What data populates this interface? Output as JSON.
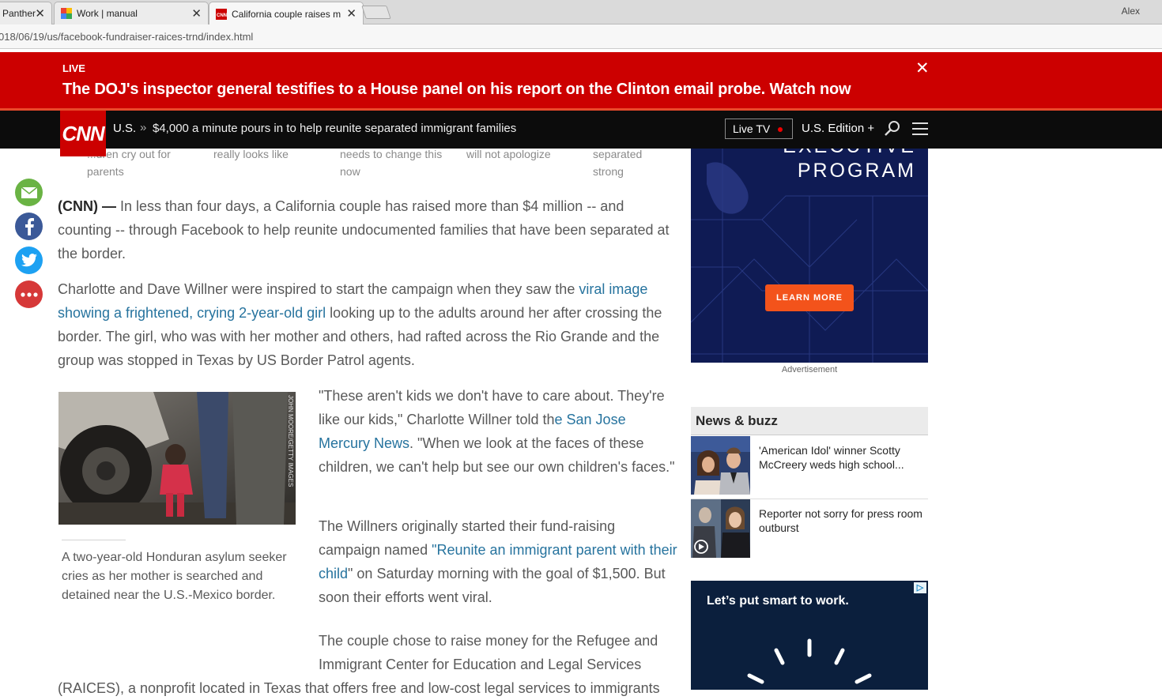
{
  "browser": {
    "tabs": [
      {
        "title": "Panther",
        "close": "✕"
      },
      {
        "title": "Work | manual",
        "close": "✕"
      },
      {
        "title": "California couple raises m",
        "close": "✕"
      }
    ],
    "user": "Alex",
    "url": "018/06/19/us/facebook-fundraiser-raices-trnd/index.html"
  },
  "live_banner": {
    "label": "LIVE",
    "message": "The DOJ's inspector general testifies to a House panel on his report on the Clinton email probe. Watch now",
    "close": "✕"
  },
  "nav": {
    "logo": "CNN",
    "section": "U.S.",
    "chevron": "»",
    "headline": "$4,000 a minute pours in to help reunite separated immigrant families",
    "live_tv": "Live TV",
    "edition": "U.S. Edition +"
  },
  "related": [
    {
      "line1": "...dren cry out for",
      "line2": "parents"
    },
    {
      "line1": "really looks like",
      "line2": ""
    },
    {
      "line1": "needs to change this",
      "line2": "now"
    },
    {
      "line1": "will not apologize",
      "line2": ""
    },
    {
      "line1": "separated",
      "line2": "strong"
    }
  ],
  "article": {
    "p1_lead": "(CNN) —",
    "p1_text": " In less than four days, a California couple has raised more than $4 million -- and counting -- through Facebook to help reunite undocumented families that have been separated at the border.",
    "p2_a": "Charlotte and Dave Willner were inspired to start the campaign when they saw the ",
    "p2_link": "viral image showing a frightened, crying 2-year-old girl",
    "p2_b": " looking up to the adults around her after crossing the border. The girl, who was with her mother and others, had rafted across the Rio Grande and the group was stopped in Texas by US Border Patrol agents.",
    "p3_a": "\"These aren't kids we don't have to care about. They're like our kids,\" Charlotte Willner told th",
    "p3_link": "e San Jose Mercury News",
    "p3_b": ". \"When we look at the faces of these children, we can't help but see our own children's faces.\"",
    "p4_a": "The Willners originally started their fund-raising campaign named ",
    "p4_link": "\"Reunite an immigrant parent with their child",
    "p4_b": "\" on Saturday morning with the goal of $1,500. But soon their efforts went viral.",
    "p5": "The couple chose to raise money for the Refugee and Immigrant Center for Education and Legal Services",
    "p6": "(RAICES), a nonprofit located in Texas that offers free and low-cost legal services to immigrants",
    "photo_credit": "JOHN MOORE/GETTY IMAGES",
    "caption": "A two-year-old Honduran asylum seeker cries as her mother is searched and detained near the U.S.-Mexico border."
  },
  "rail": {
    "ad1_prev": "EXECUTIVE",
    "ad1_title": "PROGRAM",
    "ad1_button": "LEARN MORE",
    "ad_label": "Advertisement",
    "news_buzz_title": "News & buzz",
    "news_items": [
      {
        "text": "'American Idol' winner Scotty McCreery weds high school..."
      },
      {
        "text": "Reporter not sorry for press room outburst"
      }
    ],
    "ad2_title": "Let’s put smart to work.",
    "ad2_choice": "▷"
  },
  "colors": {
    "cnn_red": "#cc0000",
    "link_blue": "#26739e",
    "email_green": "#6ab344",
    "facebook_blue": "#3b5998",
    "twitter_blue": "#1da1f2",
    "more_red": "#d63838"
  }
}
